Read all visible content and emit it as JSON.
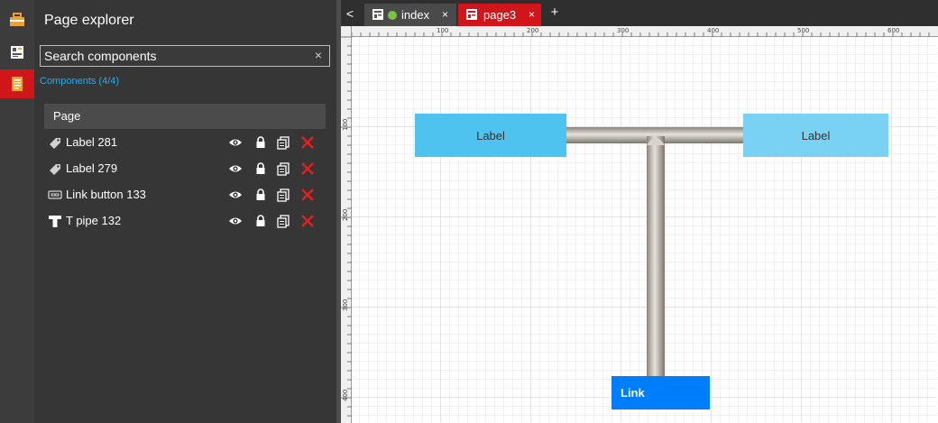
{
  "explorer": {
    "title": "Page explorer",
    "search_placeholder": "Search components",
    "clear_symbol": "×",
    "components_count": "Components (4/4)",
    "page_header": "Page",
    "components": [
      {
        "name": "Label 281",
        "icon": "tag-icon"
      },
      {
        "name": "Label 279",
        "icon": "tag-icon"
      },
      {
        "name": "Link button 133",
        "icon": "link-button-icon"
      },
      {
        "name": "T pipe 132",
        "icon": "t-pipe-icon"
      }
    ]
  },
  "rail": {
    "items": [
      {
        "icon": "toolbox-icon"
      },
      {
        "icon": "components-icon"
      },
      {
        "icon": "page-explorer-icon",
        "active": true
      }
    ]
  },
  "tabs": {
    "back_symbol": "<",
    "add_symbol": "+",
    "close_symbol": "×",
    "items": [
      {
        "label": "index",
        "active": false,
        "status_color": "#7cc241"
      },
      {
        "label": "page3",
        "active": true
      }
    ]
  },
  "ruler": {
    "top_labels": [
      "100",
      "200",
      "300",
      "400",
      "500",
      "600"
    ],
    "left_labels": [
      "100",
      "200",
      "300",
      "400"
    ]
  },
  "canvas": {
    "label_281_text": "Label",
    "label_279_text": "Label",
    "link_button_text": "Link"
  },
  "colors": {
    "accent": "#d0161b",
    "link_blue": "#2fa8e0",
    "label_281_bg": "#4fc3f0",
    "label_279_bg": "#79d1f4",
    "link_button_bg": "#007dfa",
    "delete_red": "#e02020"
  }
}
